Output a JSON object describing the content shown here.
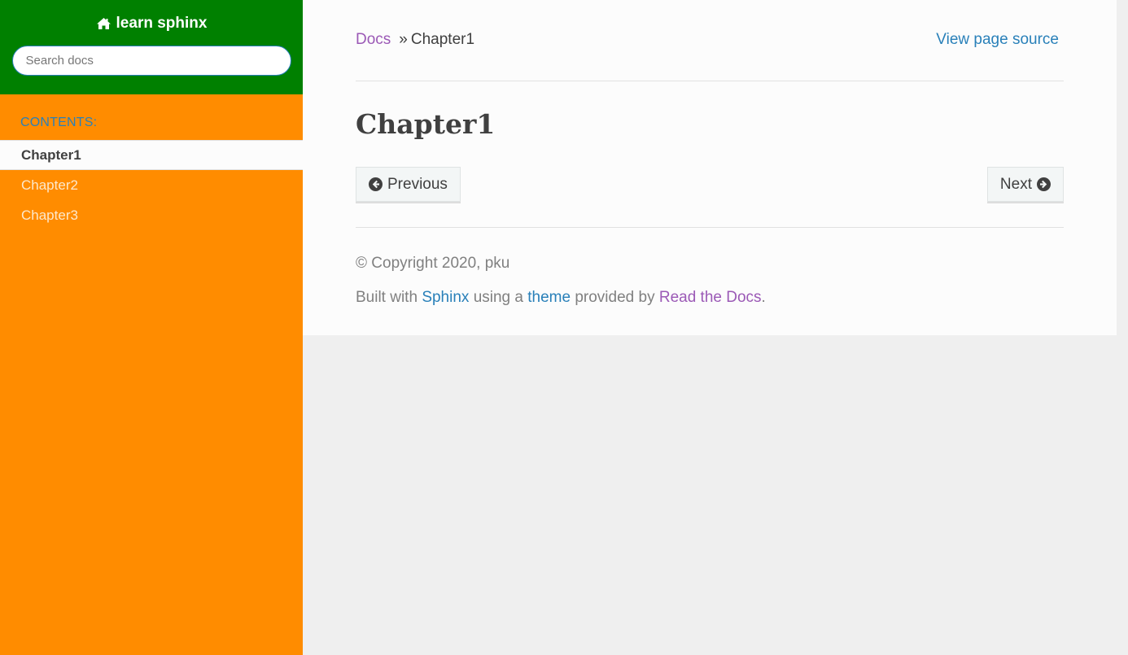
{
  "sidebar": {
    "project_name": "learn sphinx",
    "search_placeholder": "Search docs",
    "caption": "CONTENTS:",
    "items": [
      {
        "label": "Chapter1",
        "current": true
      },
      {
        "label": "Chapter2",
        "current": false
      },
      {
        "label": "Chapter3",
        "current": false
      }
    ],
    "colors": {
      "top": "#008000",
      "nav": "#ff8c00"
    }
  },
  "breadcrumb": {
    "root": "Docs",
    "separator": "»",
    "current": "Chapter1",
    "view_source": "View page source"
  },
  "page": {
    "title": "Chapter1"
  },
  "nav_buttons": {
    "previous": "Previous",
    "next": "Next"
  },
  "footer": {
    "copyright": "© Copyright 2020, pku",
    "built_prefix": "Built with ",
    "sphinx_link": "Sphinx",
    "using_text": " using a ",
    "theme_link": "theme",
    "provided_text": " provided by ",
    "rtd_link": "Read the Docs",
    "period": "."
  },
  "icons": {
    "home": "home-icon",
    "previous": "arrow-circle-left-icon",
    "next": "arrow-circle-right-icon"
  }
}
